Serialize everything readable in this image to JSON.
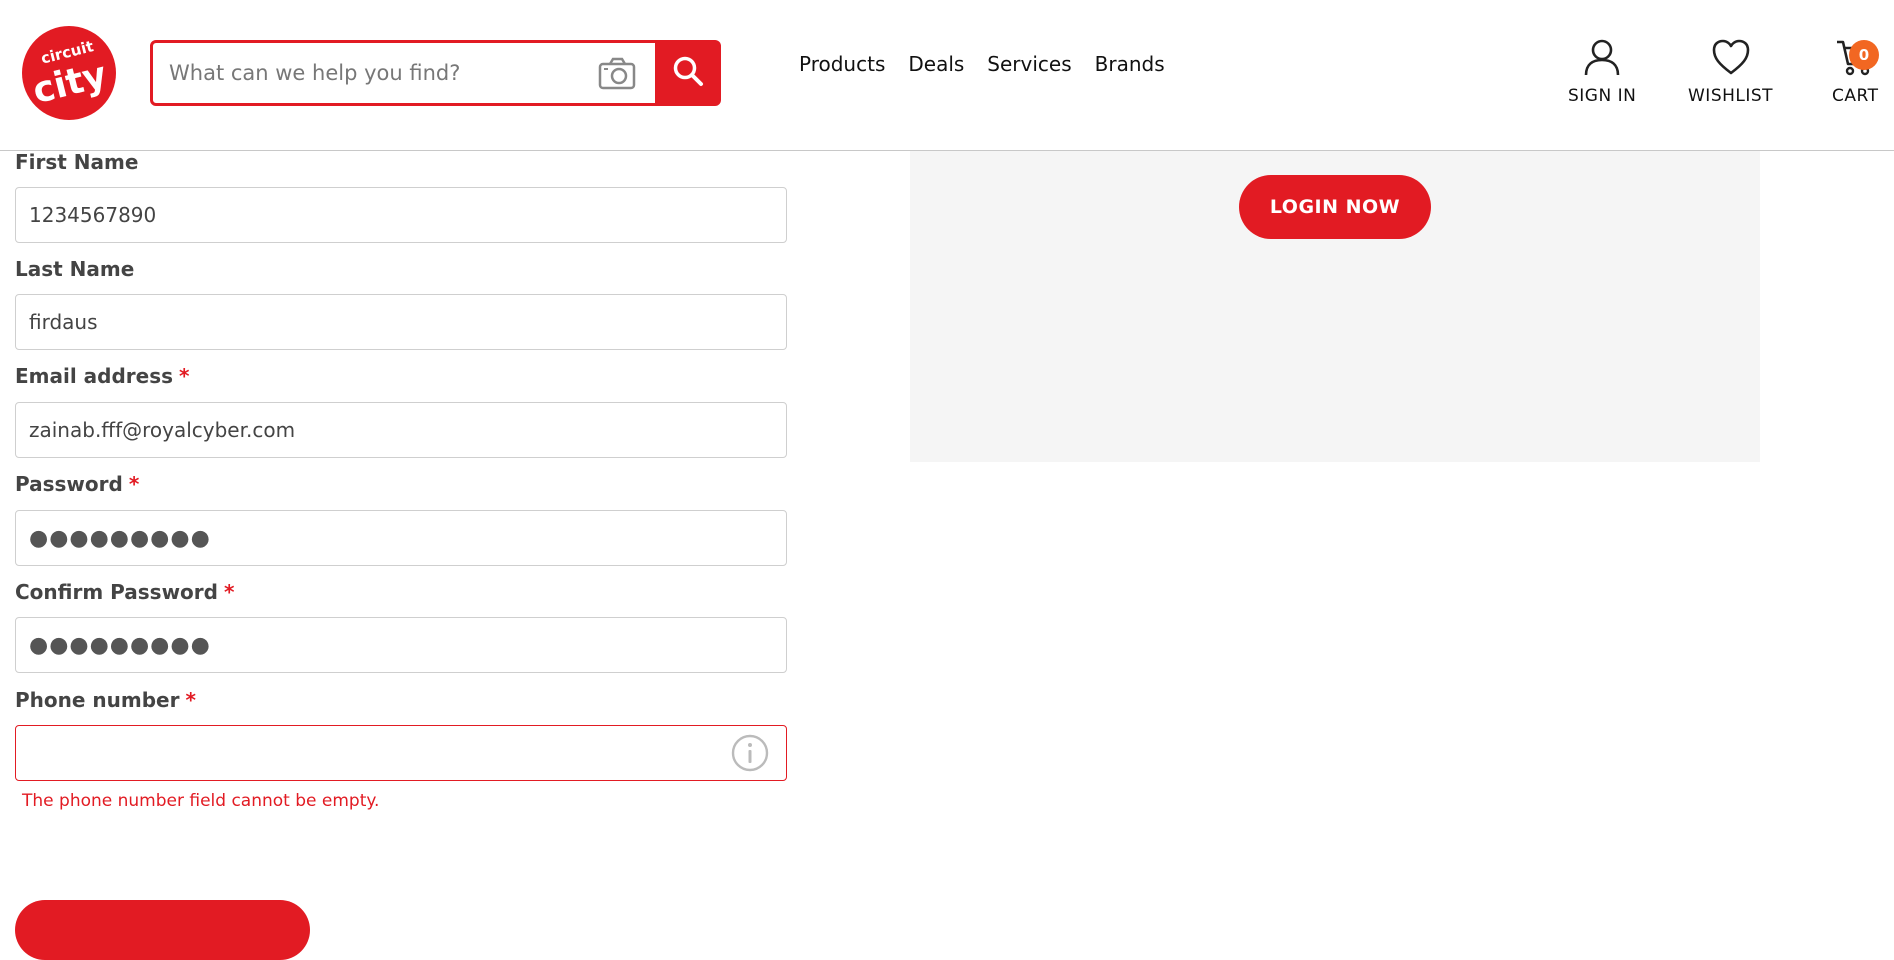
{
  "header": {
    "logo_text": "circuit city",
    "search": {
      "placeholder": "What can we help you find?",
      "value": ""
    },
    "nav": [
      "Products",
      "Deals",
      "Services",
      "Brands"
    ],
    "actions": {
      "sign_in": "SIGN IN",
      "wishlist": "WISHLIST",
      "cart": "CART",
      "cart_count": "0"
    }
  },
  "form": {
    "first_name": {
      "label": "First Name",
      "value": "1234567890"
    },
    "last_name": {
      "label": "Last Name",
      "value": "firdaus"
    },
    "email": {
      "label": "Email address",
      "required": "*",
      "value": "zainab.fff@royalcyber.com"
    },
    "password": {
      "label": "Password",
      "required": "*",
      "value": "●●●●●●●●●"
    },
    "confirm_password": {
      "label": "Confirm Password",
      "required": "*",
      "value": "●●●●●●●●●"
    },
    "phone": {
      "label": "Phone number",
      "required": "*",
      "value": "",
      "error": "The phone number field cannot be empty."
    }
  },
  "login_panel": {
    "button_label": "LOGIN NOW"
  },
  "colors": {
    "brand_red": "#e21b23",
    "badge_orange": "#f26722",
    "panel_gray": "#f5f5f5"
  },
  "icons": [
    "search-icon",
    "camera-icon",
    "user-icon",
    "heart-icon",
    "cart-icon",
    "info-icon"
  ]
}
